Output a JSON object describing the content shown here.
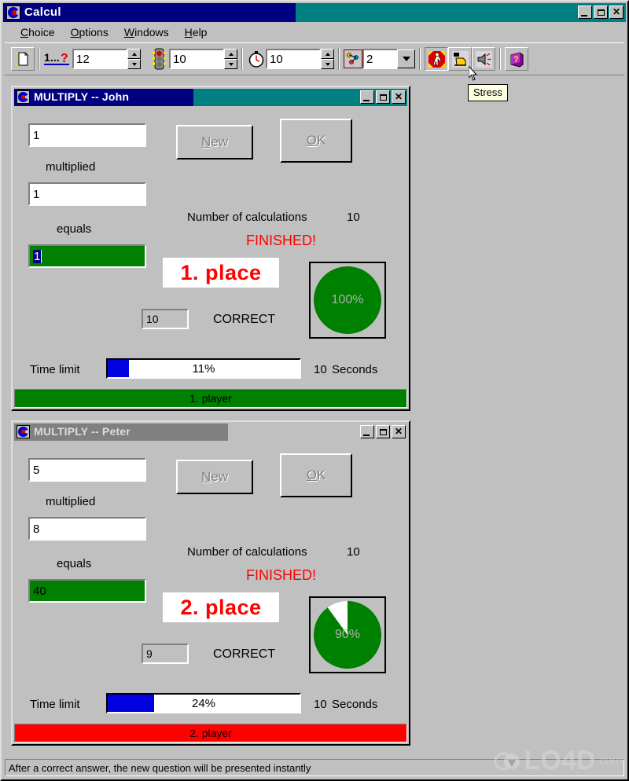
{
  "app": {
    "title": "Calcul",
    "icon": "calcul-c-icon",
    "window_controls": [
      "minimize",
      "maximize",
      "close"
    ]
  },
  "menu": [
    {
      "label": "Choice",
      "accel": "C"
    },
    {
      "label": "Options",
      "accel": "O"
    },
    {
      "label": "Windows",
      "accel": "W"
    },
    {
      "label": "Help",
      "accel": "H"
    }
  ],
  "toolbar": {
    "new_button_icon": "new-document-icon",
    "questions": {
      "icon": "one-question-icon",
      "value": "12"
    },
    "traffic": {
      "icon": "traffic-light-icon",
      "value": "10"
    },
    "timer": {
      "icon": "stopwatch-icon",
      "value": "10"
    },
    "players": {
      "icon": "players-icon",
      "value": "2"
    },
    "stress": {
      "icon": "stress-runner-icon",
      "pressed": true
    },
    "hand": {
      "icon": "hand-pointer-icon"
    },
    "sound": {
      "icon": "speaker-sound-icon"
    },
    "help": {
      "icon": "help-book-icon"
    },
    "tooltip": "Stress"
  },
  "windows": [
    {
      "title": "MULTIPLY  --  John",
      "active": true,
      "factor1": "1",
      "operation_label": "multiplied",
      "factor2": "1",
      "equals_label": "equals",
      "answer": "1",
      "answer_selected": true,
      "new_label": "New",
      "new_accel": "N",
      "ok_label": "OK",
      "ok_accel": "O",
      "calculations_label": "Number of calculations",
      "calculations_value": "10",
      "finished_label": "FINISHED!",
      "place_label": "1. place",
      "correct_count": "10",
      "correct_label": "CORRECT",
      "pie_percent": 100,
      "pie_label": "100%",
      "time_limit_label": "Time limit",
      "progress_percent": 11,
      "progress_label": "11%",
      "seconds_value": "10",
      "seconds_label": "Seconds",
      "status_label": "1. player",
      "status_color": "#008000"
    },
    {
      "title": "MULTIPLY  --  Peter",
      "active": false,
      "factor1": "5",
      "operation_label": "multiplied",
      "factor2": "8",
      "equals_label": "equals",
      "answer": "40",
      "answer_selected": false,
      "new_label": "New",
      "new_accel": "N",
      "ok_label": "OK",
      "ok_accel": "O",
      "calculations_label": "Number of calculations",
      "calculations_value": "10",
      "finished_label": "FINISHED!",
      "place_label": "2. place",
      "correct_count": "9",
      "correct_label": "CORRECT",
      "pie_percent": 90,
      "pie_label": "90%",
      "time_limit_label": "Time limit",
      "progress_percent": 24,
      "progress_label": "24%",
      "seconds_value": "10",
      "seconds_label": "Seconds",
      "status_label": "2. player",
      "status_color": "#ff0000"
    }
  ],
  "statusbar": {
    "text": "After a correct answer, the new question will be presented instantly"
  },
  "watermark": {
    "text": "LO4D",
    "suffix": ".com"
  },
  "colors": {
    "desktop": "#008080",
    "face": "#c0c0c0",
    "active_title": "#000080",
    "inactive_title": "#808080",
    "green": "#008000",
    "red": "#ff0000",
    "blue_bar": "#0000e0"
  }
}
